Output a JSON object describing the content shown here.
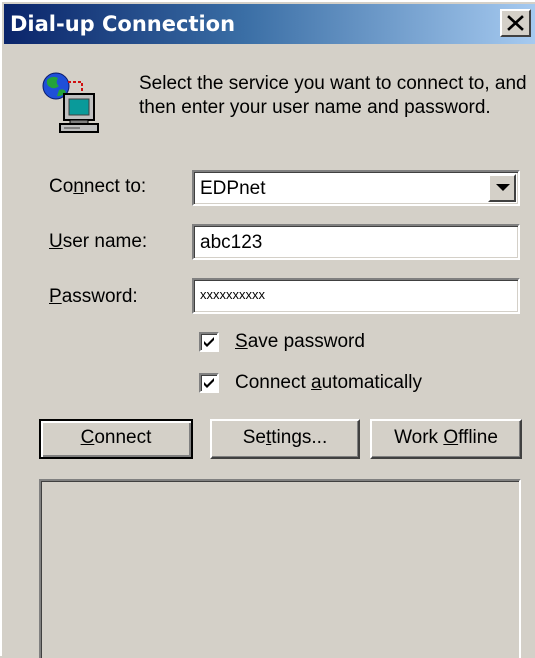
{
  "window": {
    "title": "Dial-up Connection"
  },
  "intro_text": "Select the service you want to connect to, and then enter your user name and password.",
  "form": {
    "connect_to": {
      "label_pre": "Co",
      "label_accel": "n",
      "label_post": "nect to:",
      "value": "EDPnet"
    },
    "user_name": {
      "label_pre": "",
      "label_accel": "U",
      "label_post": "ser name:",
      "value": "abc123"
    },
    "password": {
      "label_pre": "",
      "label_accel": "P",
      "label_post": "assword:",
      "value": "xxxxxxxxxx"
    },
    "save_password": {
      "checked": true,
      "label_pre": "",
      "label_accel": "S",
      "label_post": "ave password"
    },
    "connect_automatically": {
      "checked": true,
      "label_pre": "Connect ",
      "label_accel": "a",
      "label_post": "utomatically"
    }
  },
  "buttons": {
    "connect": {
      "pre": "",
      "accel": "C",
      "post": "onnect"
    },
    "settings": {
      "pre": "Se",
      "accel": "t",
      "post": "tings..."
    },
    "work_offline": {
      "pre": "Work ",
      "accel": "O",
      "post": "ffline"
    }
  },
  "icons": {
    "close": "close-icon",
    "network": "network-computer-icon",
    "dropdown": "chevron-down-icon",
    "check": "checkmark-icon"
  },
  "colors": {
    "titlebar_start": "#0a246a",
    "titlebar_end": "#a6caf0",
    "face": "#d4d0c8"
  }
}
